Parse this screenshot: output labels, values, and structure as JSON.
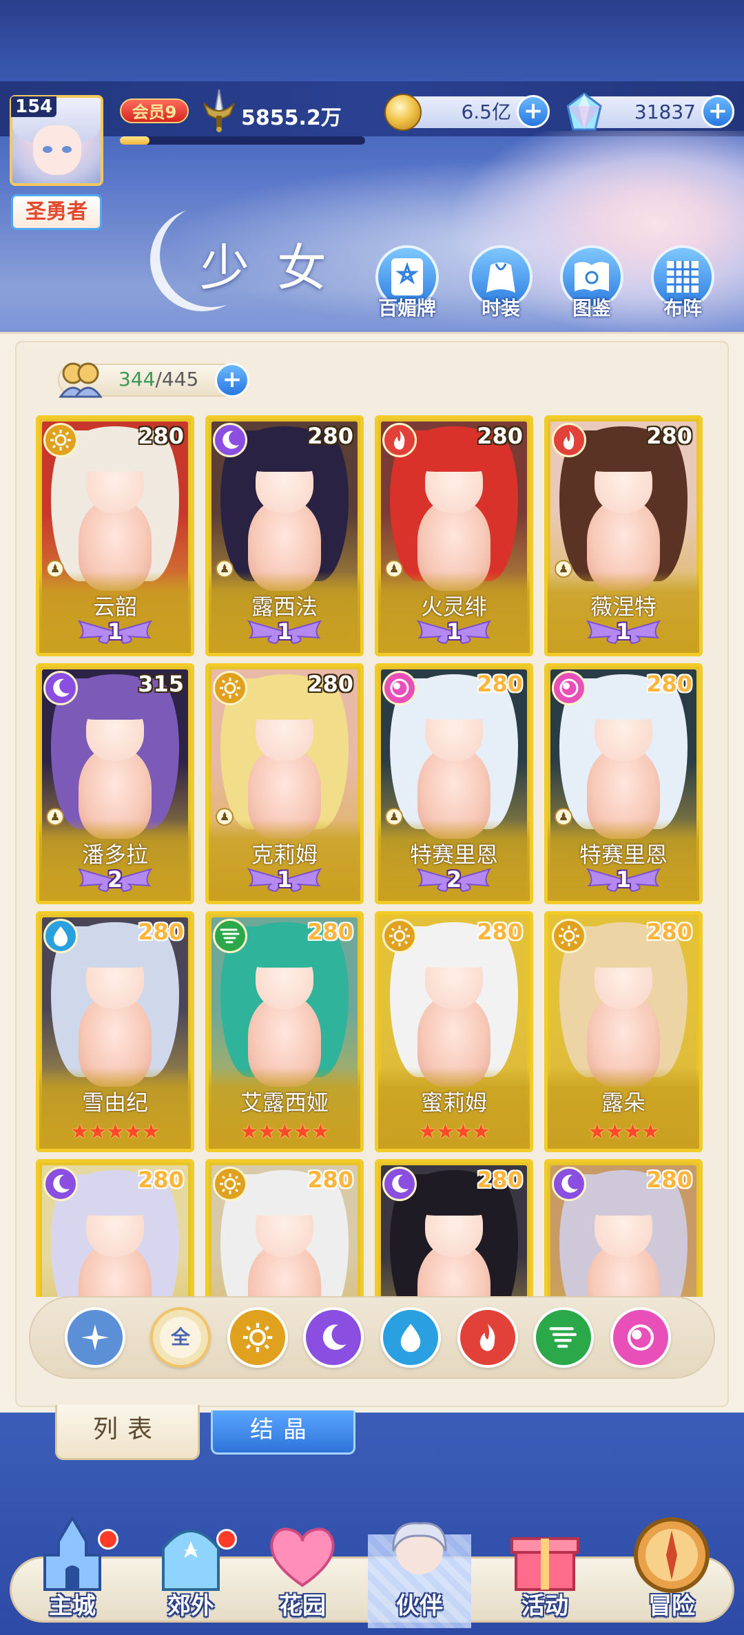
{
  "player": {
    "level": "154",
    "title": "圣勇者",
    "vip_label": "会员9",
    "power": "5855.2万",
    "exp_progress": 0.12
  },
  "currency": {
    "gold": "6.5亿",
    "diamond": "31837",
    "plus_label": "+"
  },
  "page": {
    "title": "少女"
  },
  "features": [
    {
      "label": "百媚牌",
      "icon": "star-card-icon"
    },
    {
      "label": "时装",
      "icon": "outfit-icon"
    },
    {
      "label": "图鉴",
      "icon": "book-icon"
    },
    {
      "label": "布阵",
      "icon": "formation-grid-icon"
    }
  ],
  "capacity": {
    "current": "344",
    "separator": "/",
    "max": "445",
    "plus_label": "+"
  },
  "cards": [
    {
      "name": "云韶",
      "level": "280",
      "element": "light",
      "elem_color": "#e0a21e",
      "rank": "1",
      "stars": 0,
      "art": [
        "#c8372b",
        "#efe9e0"
      ]
    },
    {
      "name": "露西法",
      "level": "280",
      "element": "moon",
      "elem_color": "#8a4fe0",
      "rank": "1",
      "stars": 0,
      "art": [
        "#5b3e36",
        "#2a2242"
      ]
    },
    {
      "name": "火灵绯",
      "level": "280",
      "element": "fire",
      "elem_color": "#e2413a",
      "rank": "1",
      "stars": 0,
      "art": [
        "#7a3b34",
        "#d9322a"
      ]
    },
    {
      "name": "薇涅特",
      "level": "280",
      "element": "fire",
      "elem_color": "#e2413a",
      "rank": "1",
      "stars": 0,
      "art": [
        "#e9c9b9",
        "#5b3324"
      ]
    },
    {
      "name": "潘多拉",
      "level": "315",
      "element": "moon",
      "elem_color": "#8a4fe0",
      "rank": "2",
      "stars": 0,
      "art": [
        "#2d2346",
        "#7c5ab8"
      ]
    },
    {
      "name": "克莉姆",
      "level": "280",
      "element": "light",
      "elem_color": "#e0a21e",
      "rank": "1",
      "stars": 0,
      "art": [
        "#e9b9a8",
        "#f1dd8a"
      ]
    },
    {
      "name": "特赛里恩",
      "level": "280",
      "element": "charm",
      "elem_color": "#e84fb8",
      "rank": "2",
      "stars": 0,
      "art": [
        "#2a3d46",
        "#e6eef8"
      ]
    },
    {
      "name": "特赛里恩",
      "level": "280",
      "element": "charm",
      "elem_color": "#e84fb8",
      "rank": "1",
      "stars": 0,
      "art": [
        "#2a3d46",
        "#e6eef8"
      ]
    },
    {
      "name": "雪由纪",
      "level": "280",
      "element": "water",
      "elem_color": "#2aa0e0",
      "rank": "",
      "stars": 5,
      "art": [
        "#4a4658",
        "#cfd8ea"
      ]
    },
    {
      "name": "艾露西娅",
      "level": "280",
      "element": "wind",
      "elem_color": "#2aa84a",
      "rank": "",
      "stars": 5,
      "art": [
        "#6ea899",
        "#2fb39a"
      ]
    },
    {
      "name": "蜜莉姆",
      "level": "280",
      "element": "light",
      "elem_color": "#e0a21e",
      "rank": "",
      "stars": 4,
      "art": [
        "#e3c23a",
        "#f2f2f2"
      ]
    },
    {
      "name": "露朵",
      "level": "280",
      "element": "light",
      "elem_color": "#e0a21e",
      "rank": "",
      "stars": 4,
      "art": [
        "#e3c23a",
        "#ecd4a4"
      ]
    },
    {
      "name": "",
      "level": "280",
      "element": "moon",
      "elem_color": "#8a4fe0",
      "rank": "",
      "stars": 0,
      "art": [
        "#e6d9a0",
        "#d8d6ee"
      ]
    },
    {
      "name": "",
      "level": "280",
      "element": "light",
      "elem_color": "#e0a21e",
      "rank": "",
      "stars": 0,
      "art": [
        "#d8c9a8",
        "#eeeeee"
      ]
    },
    {
      "name": "",
      "level": "280",
      "element": "moon",
      "elem_color": "#8a4fe0",
      "rank": "",
      "stars": 0,
      "art": [
        "#3a3642",
        "#1e1b24"
      ]
    },
    {
      "name": "",
      "level": "280",
      "element": "moon",
      "elem_color": "#8a4fe0",
      "rank": "",
      "stars": 0,
      "art": [
        "#c79a66",
        "#cfc8d8"
      ]
    }
  ],
  "filters": [
    {
      "name": "filter-special",
      "label": "",
      "color": "#5b8fd6"
    },
    {
      "name": "filter-all",
      "label": "全",
      "color": "#f3e4b8"
    },
    {
      "name": "filter-light",
      "label": "",
      "color": "#e0a21e"
    },
    {
      "name": "filter-moon",
      "label": "",
      "color": "#8a4fe0"
    },
    {
      "name": "filter-water",
      "label": "",
      "color": "#2aa0e0"
    },
    {
      "name": "filter-fire",
      "label": "",
      "color": "#e2413a"
    },
    {
      "name": "filter-wind",
      "label": "",
      "color": "#2aa84a"
    },
    {
      "name": "filter-charm",
      "label": "",
      "color": "#e84fb8"
    }
  ],
  "tabs": {
    "list": "列表",
    "crystal": "结晶"
  },
  "nav": [
    {
      "label": "主城",
      "icon": "castle-icon",
      "dot": true
    },
    {
      "label": "郊外",
      "icon": "portal-icon",
      "dot": true
    },
    {
      "label": "花园",
      "icon": "heart-icon",
      "dot": false
    },
    {
      "label": "伙伴",
      "icon": "partner-icon",
      "dot": false,
      "active": true
    },
    {
      "label": "活动",
      "icon": "gift-icon",
      "dot": false
    },
    {
      "label": "冒险",
      "icon": "compass-icon",
      "dot": false
    }
  ]
}
